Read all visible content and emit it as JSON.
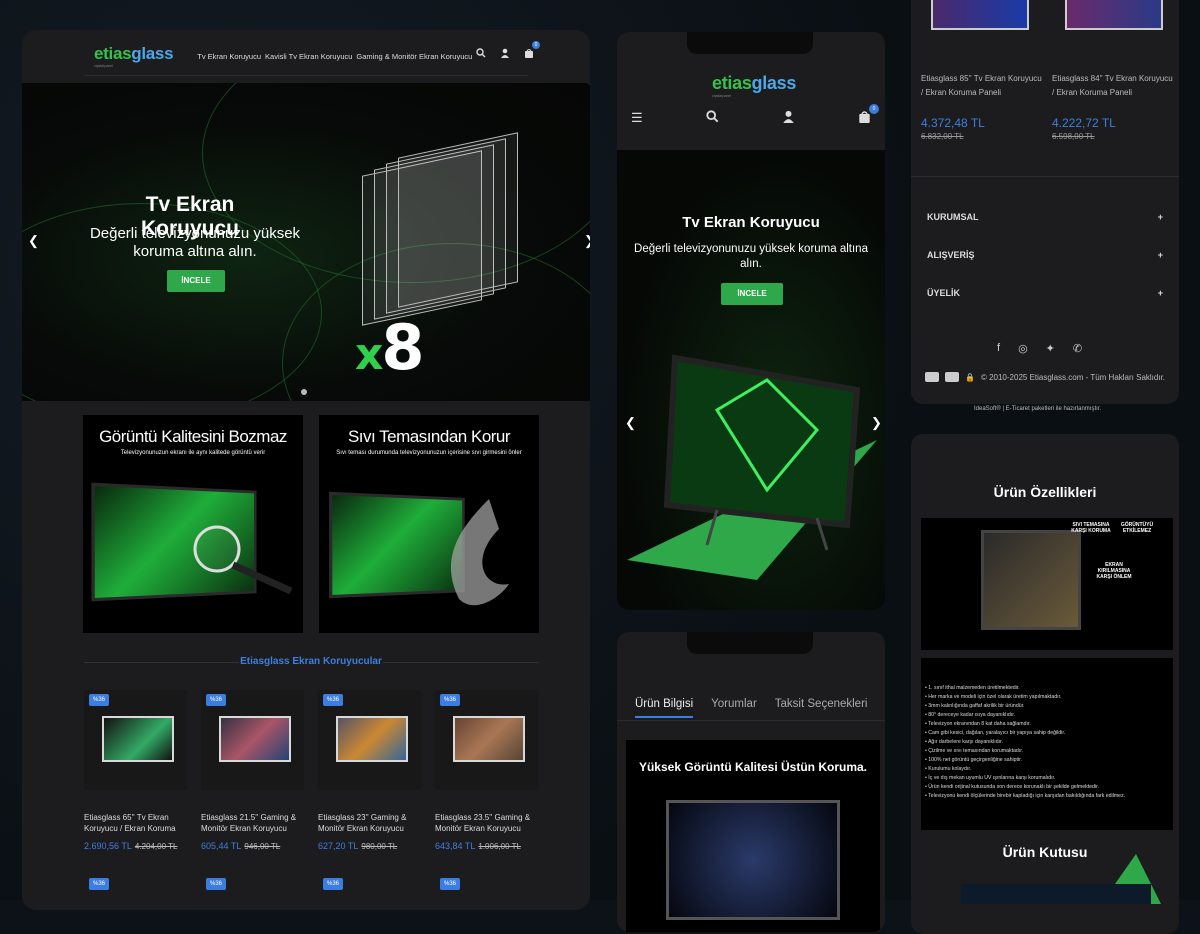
{
  "brand": {
    "name_a": "etias",
    "name_b": "glass",
    "tagline": "crystal panel"
  },
  "desktop": {
    "nav": [
      "Tv Ekran Koruyucu",
      "Kavisli Tv Ekran Koruyucu",
      "Gaming & Monitör Ekran Koruyucu"
    ],
    "cart_count": "0",
    "hero": {
      "title": "Tv Ekran Koruyucu",
      "subtitle": "Değerli televizyonunuzu yüksek koruma altına alın.",
      "button": "İNCELE",
      "badge": "x8"
    },
    "features": [
      {
        "title": "Görüntü Kalitesini Bozmaz",
        "text": "Televizyonunuzun ekranı ile aynı kalitede görüntü verir"
      },
      {
        "title": "Sıvı Temasından Korur",
        "text": "Sıvı teması durumunda televizyonunuzun içerisine sıvı girmesini önler"
      }
    ],
    "section_title": "Etiasglass Ekran Koruyucular",
    "products": [
      {
        "tag": "%36",
        "name": "Etiasglass 65'' Tv Ekran Koruyucu / Ekran Koruma",
        "price": "2.690,56 TL",
        "old": "4.204,00 TL"
      },
      {
        "tag": "%36",
        "name": "Etiasglass 21.5'' Gaming & Monitör Ekran Koruyucu",
        "price": "605,44 TL",
        "old": "946,00 TL"
      },
      {
        "tag": "%36",
        "name": "Etiasglass 23'' Gaming & Monitör Ekran Koruyucu",
        "price": "627,20 TL",
        "old": "980,00 TL"
      },
      {
        "tag": "%36",
        "name": "Etiasglass 23.5'' Gaming & Monitör Ekran Koruyucu",
        "price": "643,84 TL",
        "old": "1.006,00 TL"
      }
    ],
    "row2_tag": "%36"
  },
  "mobile1": {
    "cart_count": "0",
    "hero": {
      "title": "Tv Ekran Koruyucu",
      "subtitle": "Değerli televizyonunuzu yüksek koruma altına alın.",
      "button": "İNCELE"
    }
  },
  "mobile2": {
    "tabs": [
      "Ürün Bilgisi",
      "Yorumlar",
      "Taksit Seçenekleri"
    ],
    "banner": "Yüksek Görüntü Kalitesi Üstün Koruma."
  },
  "right_top": {
    "products": [
      {
        "name": "Etiasglass 85'' Tv Ekran Koruyucu / Ekran Koruma Paneli",
        "price": "4.372,48 TL",
        "old": "6.832,00 TL"
      },
      {
        "name": "Etiasglass 84'' Tv Ekran Koruyucu / Ekran Koruma Paneli",
        "price": "4.222,72 TL",
        "old": "6.598,00 TL"
      }
    ],
    "accordion": [
      "KURUMSAL",
      "ALIŞVERİŞ",
      "ÜYELİK"
    ],
    "copyright": "© 2010-2025 Etiasglass.com - Tüm Hakları Saklıdır.",
    "footer_note": "IdeaSoft® | E-Ticaret paketleri ile hazırlanmıştır."
  },
  "right_bottom": {
    "title": "Ürün Özellikleri",
    "labels": [
      "SIVI TEMASINA KARŞI KORUMA",
      "GÖRÜNTÜYÜ ETKİLEMEZ",
      "EKRAN KIRILMASINA KARŞI ÖNLEM"
    ],
    "features": [
      "• 1. sınıf ithal malzemeden üretilmektedir.",
      "• Her marka ve modeli için özel olarak üretim yapılmaktadır.",
      "• 3mm kalınlığında gaffaf akrilik bir üründür.",
      "• 80° dereceye kadar ısıya dayanıklıdır.",
      "• Televizyon ekranından 8 kat daha sağlamdır.",
      "• Cam gibi kesici, dağılan, yaralayıcı bir yapıya sahip değildir.",
      "• Ağır darbelere karşı dayanıklıdır.",
      "• Çizilme ve sıvı temasından korumaktadır.",
      "• 100% net görüntü geçirgenliğine sahiptir.",
      "• Kurulumu kolaydır.",
      "• İç ve dış mekan uyumlu UV ışınlarına karşı korumalıdır.",
      "• Ürün kendi orijinal kutusunda son derece korunaklı bir şekilde gelmektedir.",
      "• Televizyonu kendi ölçülerinde birebir kapladığı için karşıdan bakıldığında fark edilmez."
    ],
    "box_title": "Ürün Kutusu"
  },
  "colors": {
    "accent_green": "#2ea84a",
    "accent_blue": "#3d7fe0",
    "panel": "#1c1c1e"
  }
}
